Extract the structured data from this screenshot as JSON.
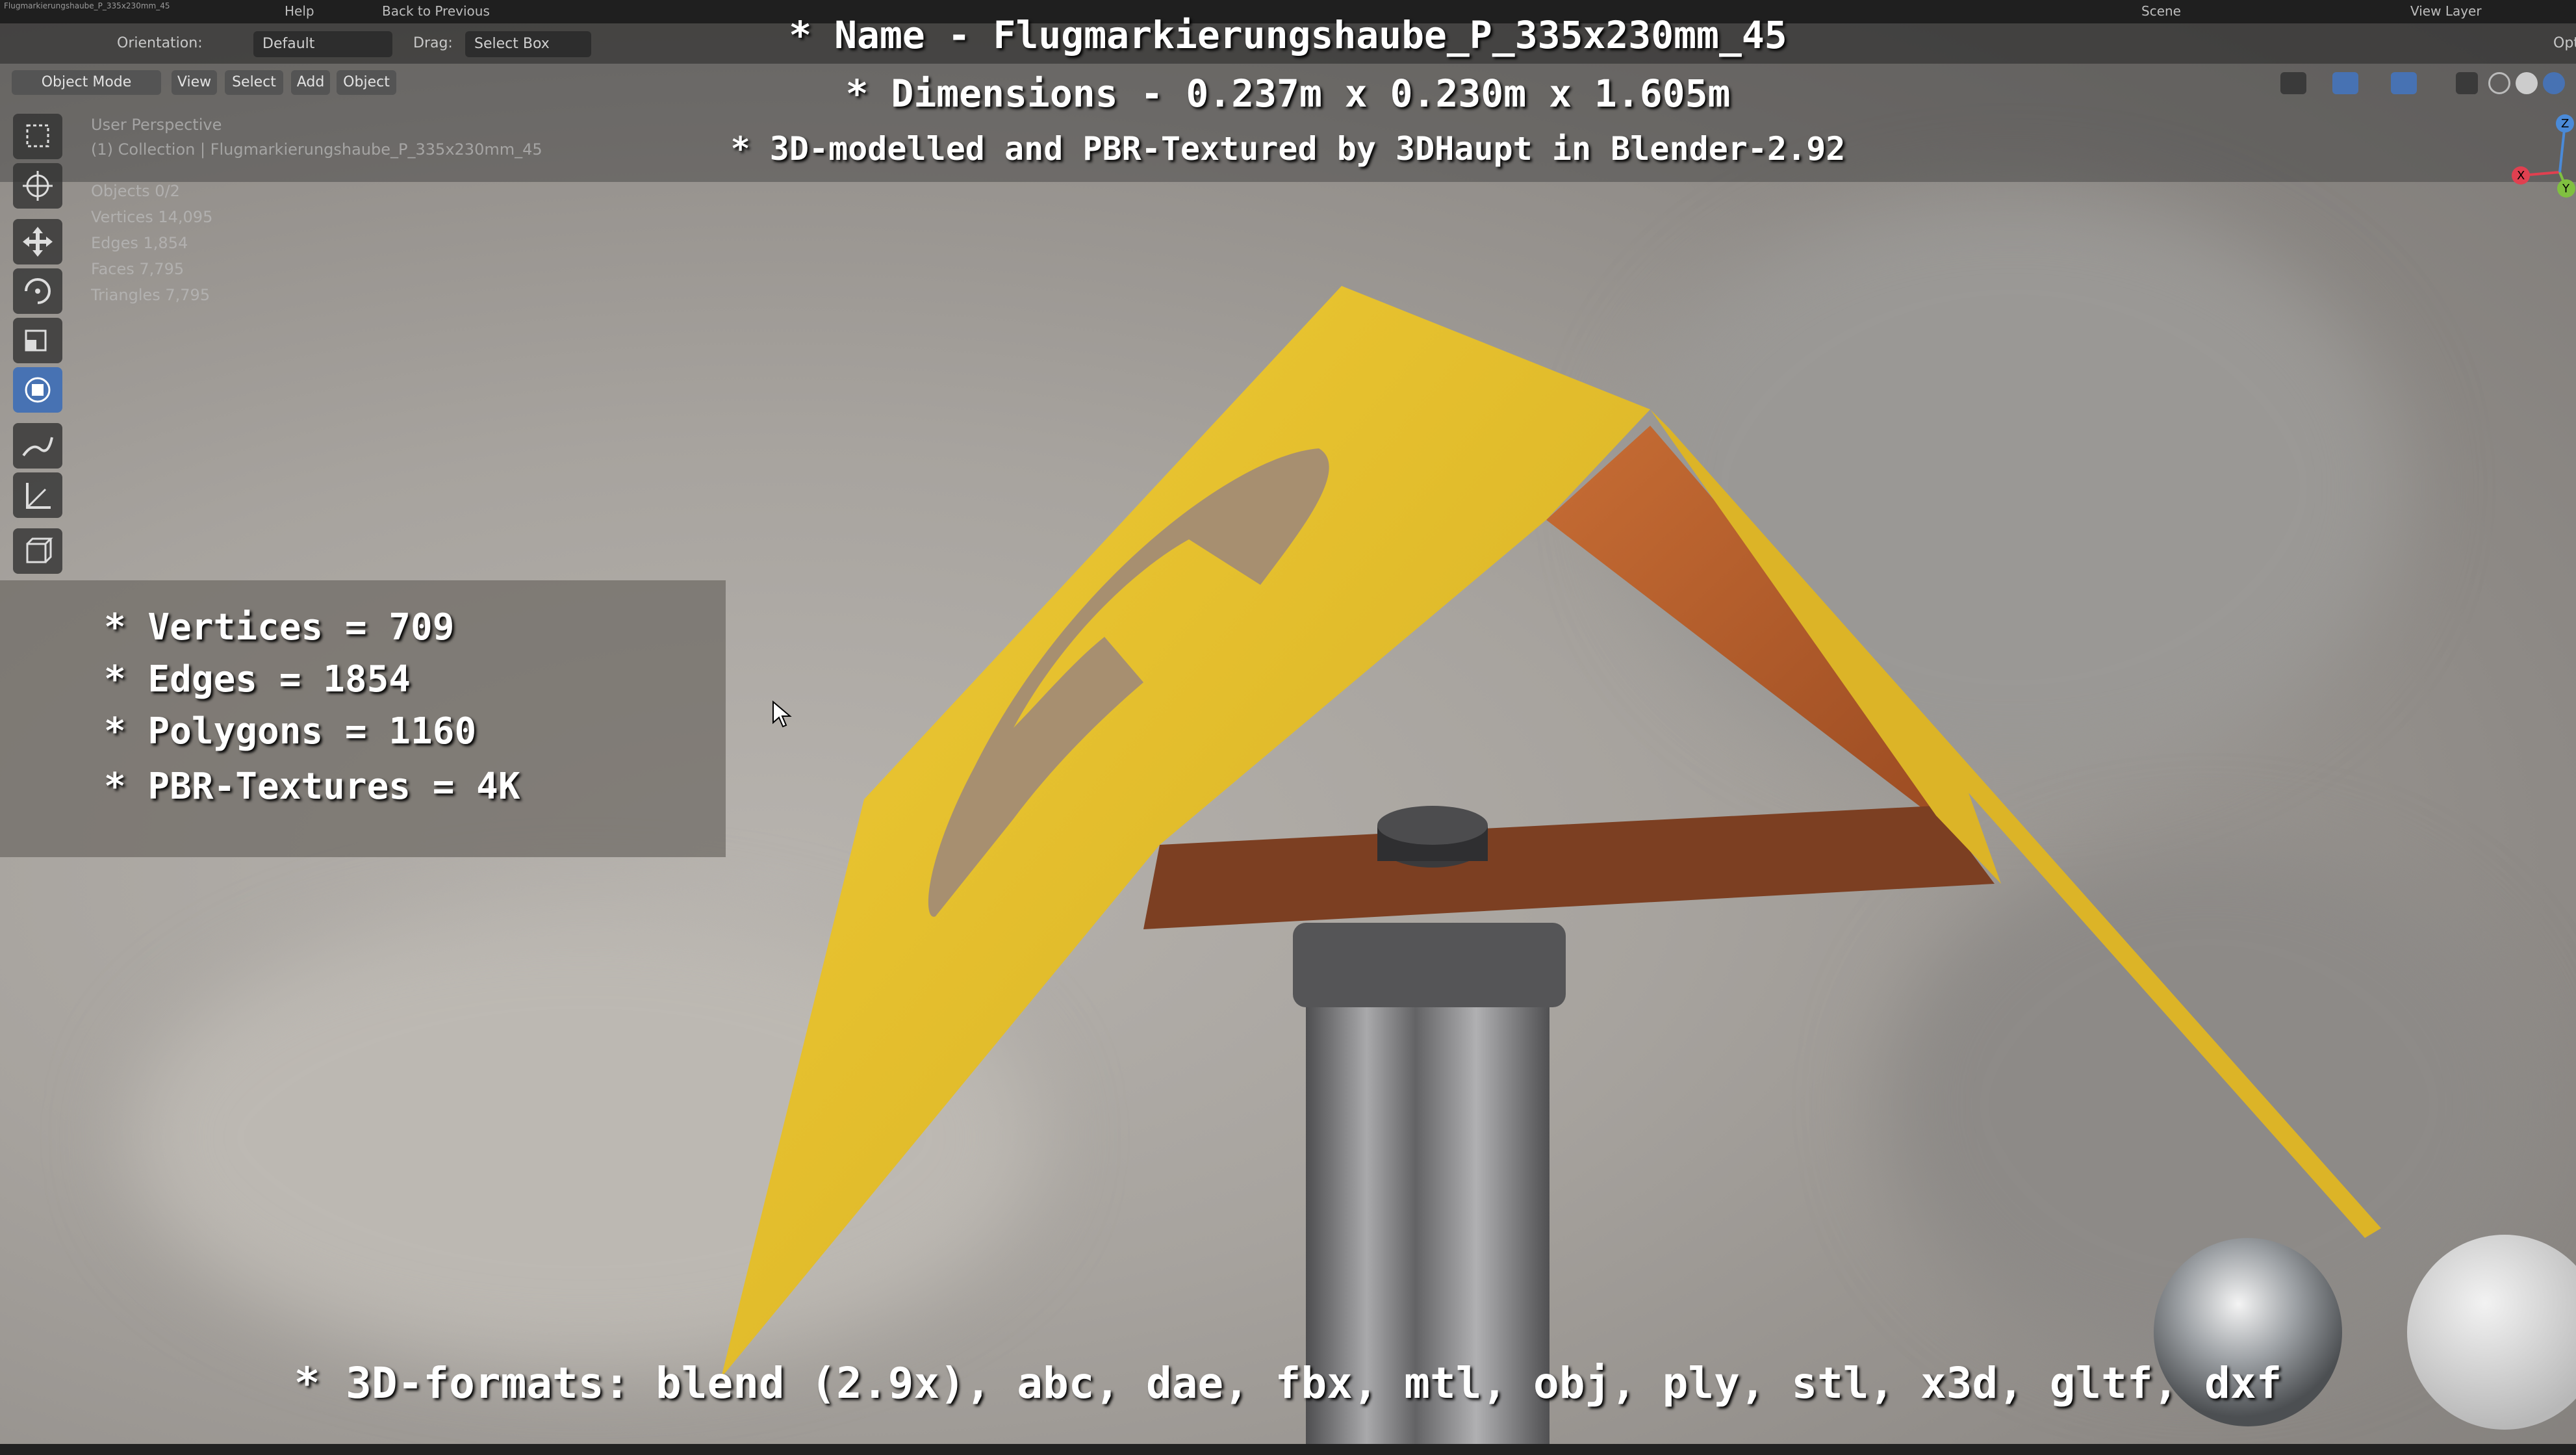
{
  "topbar": {
    "file_path": "Flugmarkierungshaube_P_335x230mm_45",
    "help_label": "Help",
    "back_label": "Back to Previous",
    "scene_label": "Scene",
    "view_layer_label": "View Layer"
  },
  "header": {
    "orientation_label": "Orientation:",
    "orientation_value": "Default",
    "drag_label": "Drag:",
    "drag_value": "Select Box",
    "options_label": "Opti"
  },
  "header_bar": {
    "mode_label": "Object Mode",
    "menus": [
      "View",
      "Select",
      "Add",
      "Object"
    ]
  },
  "overlay_info": {
    "view_name": "User Perspective",
    "collection": "(1) Collection | Flugmarkierungshaube_P_335x230mm_45",
    "objects": "Objects   0/2",
    "vertices": "Vertices   14,095",
    "edges": "Edges   1,854",
    "faces": "Faces   7,795",
    "triangles": "Triangles   7,795"
  },
  "titles": {
    "name": "* Name - Flugmarkierungshaube_P_335x230mm_45",
    "dimensions": "* Dimensions -  0.237m x 0.230m x 1.605m",
    "credit": "* 3D-modelled and PBR-Textured by 3DHaupt in Blender-2.92"
  },
  "stats": {
    "vertices": "* Vertices = 709",
    "edges": "* Edges = 1854",
    "polygons": "* Polygons = 1160",
    "textures": "* PBR-Textures = 4K"
  },
  "formats": "* 3D-formats: blend (2.9x), abc, dae, fbx, mtl, obj, ply, stl, x3d, gltf, dxf",
  "gizmo": {
    "x": "X",
    "y": "Y",
    "z": "Z"
  },
  "colors": {
    "yellow": "#e8c32d",
    "orange_under": "#c4692e",
    "ui_dark": "#1f1f1f",
    "active_tool": "#4772b3"
  }
}
